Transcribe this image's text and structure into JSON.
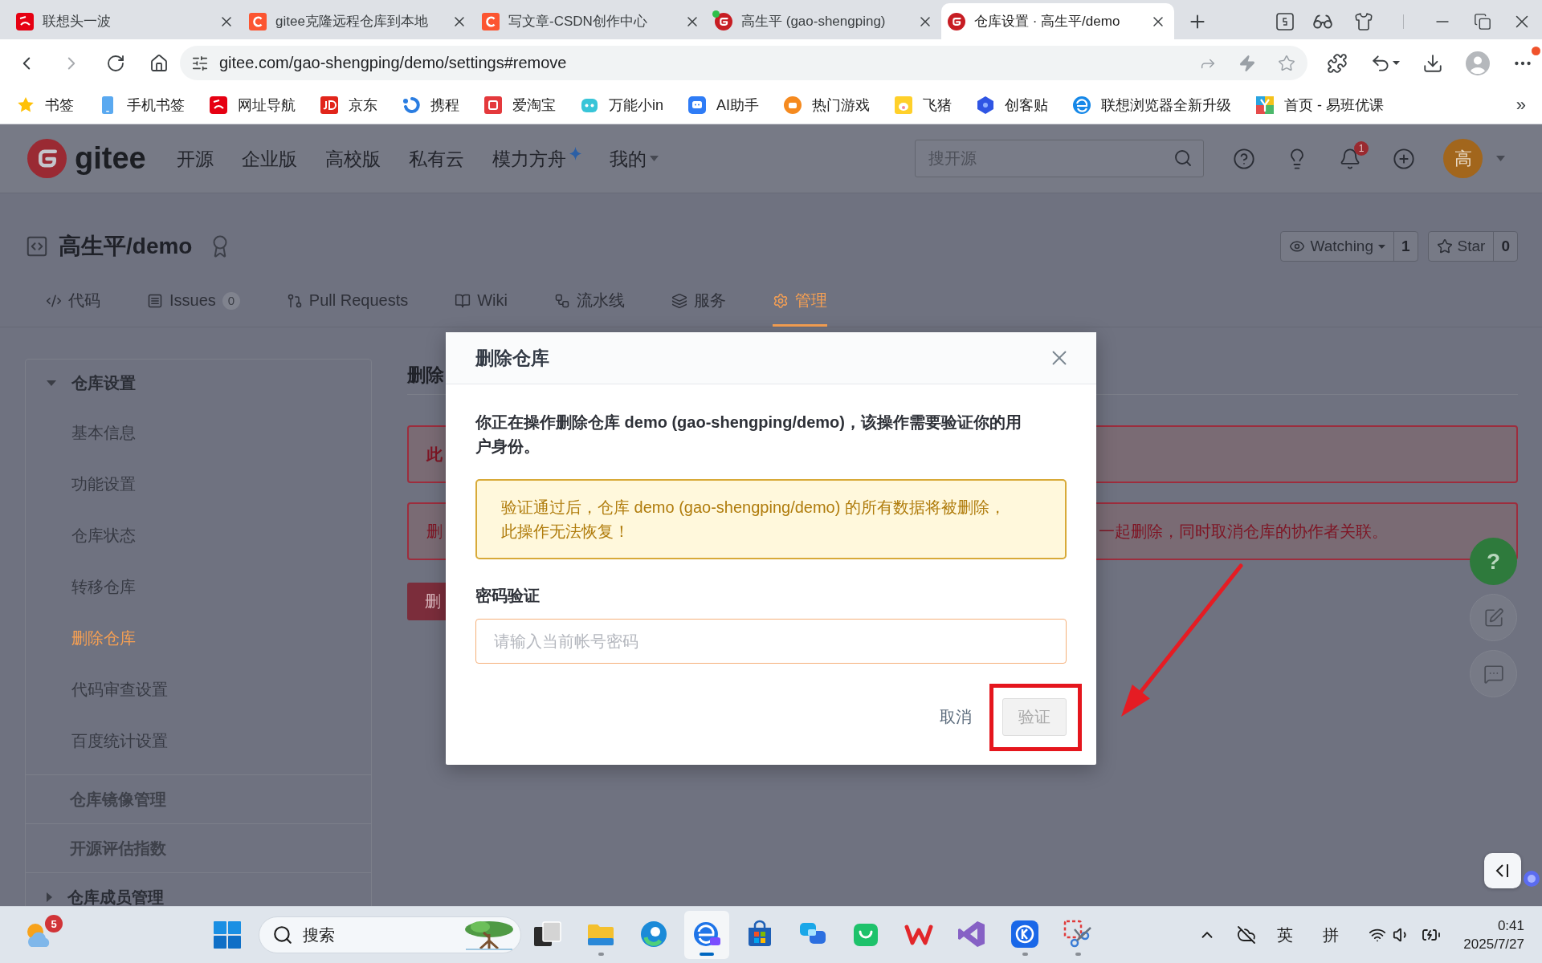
{
  "browser": {
    "tabs": [
      {
        "title": "联想头一波",
        "kind": "lenovo",
        "dot": false,
        "selected": false
      },
      {
        "title": "gitee克隆远程仓库到本地",
        "kind": "csdn",
        "dot": false,
        "selected": false
      },
      {
        "title": "写文章-CSDN创作中心",
        "kind": "csdn",
        "dot": false,
        "selected": false
      },
      {
        "title": "高生平 (gao-shengping)",
        "kind": "gitee",
        "dot": true,
        "selected": false
      },
      {
        "title": "仓库设置 · 高生平/demo",
        "kind": "gitee",
        "dot": false,
        "selected": true
      }
    ],
    "address": "gitee.com/gao-shengping/demo/settings#remove",
    "forward_disabled": true,
    "menu_dot": true,
    "bookmarks": [
      {
        "label": "书签",
        "kind": "star"
      },
      {
        "label": "手机书签",
        "kind": "phone"
      },
      {
        "label": "网址导航",
        "kind": "lenovo"
      },
      {
        "label": "京东",
        "kind": "jd"
      },
      {
        "label": "携程",
        "kind": "ctrip"
      },
      {
        "label": "爱淘宝",
        "kind": "taobao"
      },
      {
        "label": "万能小in",
        "kind": "robot"
      },
      {
        "label": "AI助手",
        "kind": "assistant"
      },
      {
        "label": "热门游戏",
        "kind": "game"
      },
      {
        "label": "飞猪",
        "kind": "pig"
      },
      {
        "label": "创客贴",
        "kind": "tag"
      },
      {
        "label": "联想浏览器全新升级",
        "kind": "browser"
      },
      {
        "label": "首页 - 易班优课",
        "kind": "yiban"
      }
    ],
    "bookmarks_more": "»"
  },
  "site_header": {
    "logo_text": "gitee",
    "nav": [
      {
        "label": "开源",
        "kind": "plain"
      },
      {
        "label": "企业版",
        "kind": "plain"
      },
      {
        "label": "高校版",
        "kind": "plain"
      },
      {
        "label": "私有云",
        "kind": "plain"
      },
      {
        "label": "模力方舟",
        "kind": "sparkle"
      },
      {
        "label": "我的",
        "kind": "dropdown"
      }
    ],
    "search": {
      "placeholder": "搜开源"
    },
    "notification_count": "1",
    "avatar": "高"
  },
  "repo": {
    "title": "高生平/demo",
    "watch": {
      "label": "Watching",
      "count": "1"
    },
    "star": {
      "label": "Star",
      "count": "0"
    },
    "tabs": [
      {
        "label": "代码",
        "kind": "code",
        "selected": false
      },
      {
        "label": "Issues",
        "kind": "issues",
        "count": "0",
        "selected": false
      },
      {
        "label": "Pull Requests",
        "kind": "pull-request",
        "selected": false
      },
      {
        "label": "Wiki",
        "kind": "wiki",
        "selected": false
      },
      {
        "label": "流水线",
        "kind": "pipeline",
        "selected": false
      },
      {
        "label": "服务",
        "kind": "service",
        "selected": false
      },
      {
        "label": "管理",
        "kind": "manage",
        "selected": true
      }
    ]
  },
  "sidebar": {
    "sections": [
      {
        "kind": "group",
        "label": "仓库设置",
        "expanded": true,
        "items": [
          {
            "label": "基本信息",
            "selected": false
          },
          {
            "label": "功能设置",
            "selected": false
          },
          {
            "label": "仓库状态",
            "selected": false
          },
          {
            "label": "转移仓库",
            "selected": false
          },
          {
            "label": "删除仓库",
            "selected": true
          },
          {
            "label": "代码审查设置",
            "selected": false
          },
          {
            "label": "百度统计设置",
            "selected": false
          }
        ]
      },
      {
        "kind": "link",
        "label": "仓库镜像管理"
      },
      {
        "kind": "link",
        "label": "开源评估指数"
      },
      {
        "kind": "group",
        "label": "仓库成员管理",
        "expanded": false
      }
    ]
  },
  "settings_panel": {
    "heading": "删除",
    "notices": [
      {
        "kind": "strong",
        "texts": [
          "此"
        ]
      },
      {
        "kind": "plain",
        "texts": [
          "删",
          "一起删除，同时取消仓库的协作者关联。"
        ]
      }
    ],
    "button": "删"
  },
  "dialog": {
    "title": "删除仓库",
    "message": "你正在操作删除仓库 demo (gao-shengping/demo)，该操作需要验证你的用户身份。",
    "warning": "验证通过后，仓库 demo (gao-shengping/demo) 的所有数据将被删除，此操作无法恢复！",
    "field_label": "密码验证",
    "password": {
      "placeholder": "请输入当前帐号密码",
      "focused": true
    },
    "cancel": "取消",
    "confirm": {
      "label": "验证",
      "disabled": true
    }
  },
  "help_button": "?",
  "taskbar": {
    "weather_badge": "5",
    "search": {
      "placeholder": "搜索"
    },
    "apps": [
      {
        "kind": "taskview",
        "running": false,
        "active": false
      },
      {
        "kind": "explorer",
        "running": true,
        "active": false
      },
      {
        "kind": "edge",
        "running": false,
        "active": false
      },
      {
        "kind": "lenovo-ai",
        "running": true,
        "active": true
      },
      {
        "kind": "store",
        "running": false,
        "active": false
      },
      {
        "kind": "copilot",
        "running": false,
        "active": false
      },
      {
        "kind": "bag",
        "running": false,
        "active": false
      },
      {
        "kind": "wps",
        "running": false,
        "active": false
      },
      {
        "kind": "vs",
        "running": false,
        "active": false
      },
      {
        "kind": "k",
        "running": true,
        "active": false
      },
      {
        "kind": "snip",
        "running": true,
        "active": false
      }
    ],
    "ime_language": "英",
    "ime_mode": "拼",
    "time": "0:41",
    "date": "2025/7/27"
  }
}
